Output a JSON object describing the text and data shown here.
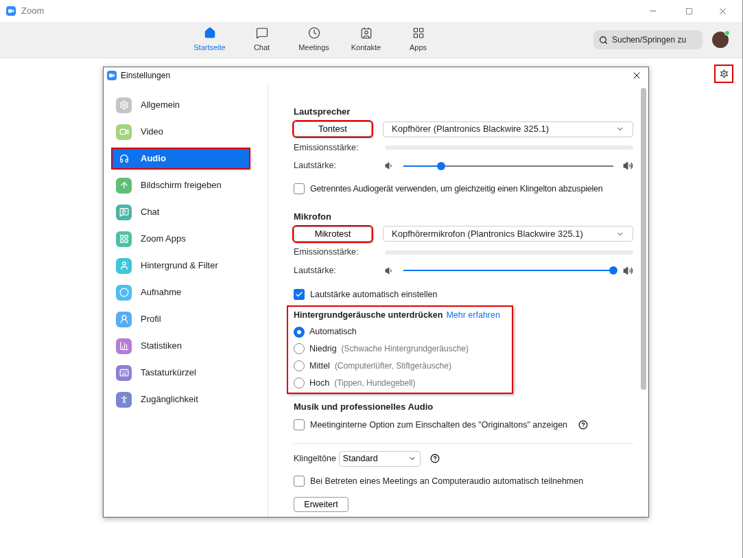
{
  "app_window": {
    "title": "Zoom"
  },
  "nav_tabs": [
    {
      "label": "Startseite",
      "selected": true,
      "kind": "home"
    },
    {
      "label": "Chat",
      "selected": false,
      "kind": "chat"
    },
    {
      "label": "Meetings",
      "selected": false,
      "kind": "clock"
    },
    {
      "label": "Kontakte",
      "selected": false,
      "kind": "contact"
    },
    {
      "label": "Apps",
      "selected": false,
      "kind": "apps"
    }
  ],
  "search": {
    "placeholder": "Suchen/Springen zu"
  },
  "settings_dialog": {
    "title": "Einstellungen"
  },
  "sidebar": {
    "items": [
      {
        "label": "Allgemein",
        "selected": false,
        "color": "#c4c4c4",
        "kind": "gear"
      },
      {
        "label": "Video",
        "selected": false,
        "color": "#a3d47e",
        "kind": "video"
      },
      {
        "label": "Audio",
        "selected": true,
        "kind": "headphones"
      },
      {
        "label": "Bildschirm freigeben",
        "selected": false,
        "color": "#5fbf73",
        "kind": "share"
      },
      {
        "label": "Chat",
        "selected": false,
        "color": "#4bb5a4",
        "kind": "chat"
      },
      {
        "label": "Zoom Apps",
        "selected": false,
        "color": "#4fc0a5",
        "kind": "apps"
      },
      {
        "label": "Hintergrund & Filter",
        "selected": false,
        "color": "#3fc6d8",
        "kind": "person"
      },
      {
        "label": "Aufnahme",
        "selected": false,
        "color": "#4ebdf2",
        "kind": "record"
      },
      {
        "label": "Profil",
        "selected": false,
        "color": "#58acf0",
        "kind": "profile"
      },
      {
        "label": "Statistiken",
        "selected": false,
        "color": "#b57cd6",
        "kind": "stats"
      },
      {
        "label": "Tastaturkürzel",
        "selected": false,
        "color": "#8b80d6",
        "kind": "keyboard"
      },
      {
        "label": "Zugänglichkeit",
        "selected": false,
        "color": "#7a86cf",
        "kind": "access"
      }
    ]
  },
  "speaker": {
    "heading": "Lautsprecher",
    "test_button": "Tontest",
    "device": "Kopfhörer (Plantronics Blackwire 325.1)",
    "output_label": "Emissionsstärke:",
    "volume_label": "Lautstärke:",
    "volume": {
      "level": 0.18
    }
  },
  "separate_ringer": {
    "label": "Getrenntes Audiogerät verwenden, um gleichzeitig einen Klingelton abzuspielen",
    "checked": false
  },
  "microphone": {
    "heading": "Mikrofon",
    "test_button": "Mikrotest",
    "device": "Kopfhörermikrofon (Plantronics Blackwire 325.1)",
    "output_label": "Emissionsstärke:",
    "volume_label": "Lautstärke:",
    "volume": {
      "level": 1.0
    }
  },
  "auto_volume": {
    "label": "Lautstärke automatisch einstellen",
    "checked": true
  },
  "noise_suppression": {
    "heading": "Hintergrundgeräusche unterdrücken",
    "link": "Mehr erfahren",
    "options": [
      {
        "label": "Automatisch",
        "selected": true
      },
      {
        "label": "Niedrig",
        "hint": "(Schwache Hintergrundgeräusche)",
        "selected": false
      },
      {
        "label": "Mittel",
        "hint": "(Computerlüfter, Stiftgeräusche)",
        "selected": false
      },
      {
        "label": "Hoch",
        "hint": "(Tippen, Hundegebell)",
        "selected": false
      }
    ]
  },
  "music_audio": {
    "heading": "Musik und professionelles Audio",
    "option": {
      "label": "Meetinginterne Option zum Einschalten des \"Originaltons\" anzeigen",
      "checked": false
    }
  },
  "ringtones": {
    "label": "Klingeltöne",
    "value": "Standard"
  },
  "auto_join": {
    "label": "Bei Betreten eines Meetings an Computeraudio automatisch teilnehmen",
    "checked": false
  },
  "advanced_button": "Erweitert"
}
